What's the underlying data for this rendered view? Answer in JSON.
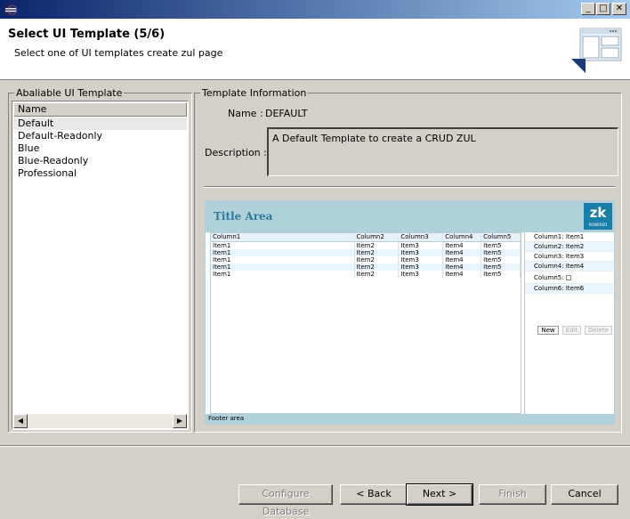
{
  "window": {
    "title": "",
    "buttons": {
      "minimize": "_",
      "maximize": "□",
      "close": "✕"
    }
  },
  "header": {
    "title": "Select UI Template (5/6)",
    "description": "Select one of UI templates create zul page"
  },
  "template_list": {
    "group_label": "Abaliable UI Template",
    "column_header": "Name",
    "items": [
      "Default",
      "Default-Readonly",
      "Blue",
      "Blue-Readonly",
      "Professional"
    ],
    "selected": "Default"
  },
  "template_info": {
    "group_label": "Template Information",
    "name_label": "Name :",
    "name_value": "DEFAULT",
    "description_label": "Description :",
    "description_value": "A Default Template to create a CRUD ZUL"
  },
  "preview": {
    "title": "Title Area",
    "logo": "zk",
    "logo_sub": "POWERED",
    "columns": [
      "Column1",
      "Column2",
      "Column3",
      "Column4",
      "Column5"
    ],
    "rows": [
      [
        "Item1",
        "Item2",
        "Item3",
        "Item4",
        "Item5"
      ],
      [
        "Item1",
        "Item2",
        "Item3",
        "Item4",
        "Item5"
      ],
      [
        "Item1",
        "Item2",
        "Item3",
        "Item4",
        "Item5"
      ],
      [
        "Item1",
        "Item2",
        "Item3",
        "Item4",
        "Item5"
      ],
      [
        "Item1",
        "Item2",
        "Item3",
        "Item4",
        "Item5"
      ]
    ],
    "form_rows": [
      "Column1: Item1",
      "Column2: Item2",
      "Column3: Item3",
      "Column4: Item4",
      "Column5:",
      "Column6: Item6"
    ],
    "form_buttons": [
      "New",
      "Edit",
      "Delete"
    ],
    "footer": "Footer area"
  },
  "buttons": {
    "configure_db": "Configure Database",
    "back": "< Back",
    "next": "Next >",
    "finish": "Finish",
    "cancel": "Cancel"
  }
}
